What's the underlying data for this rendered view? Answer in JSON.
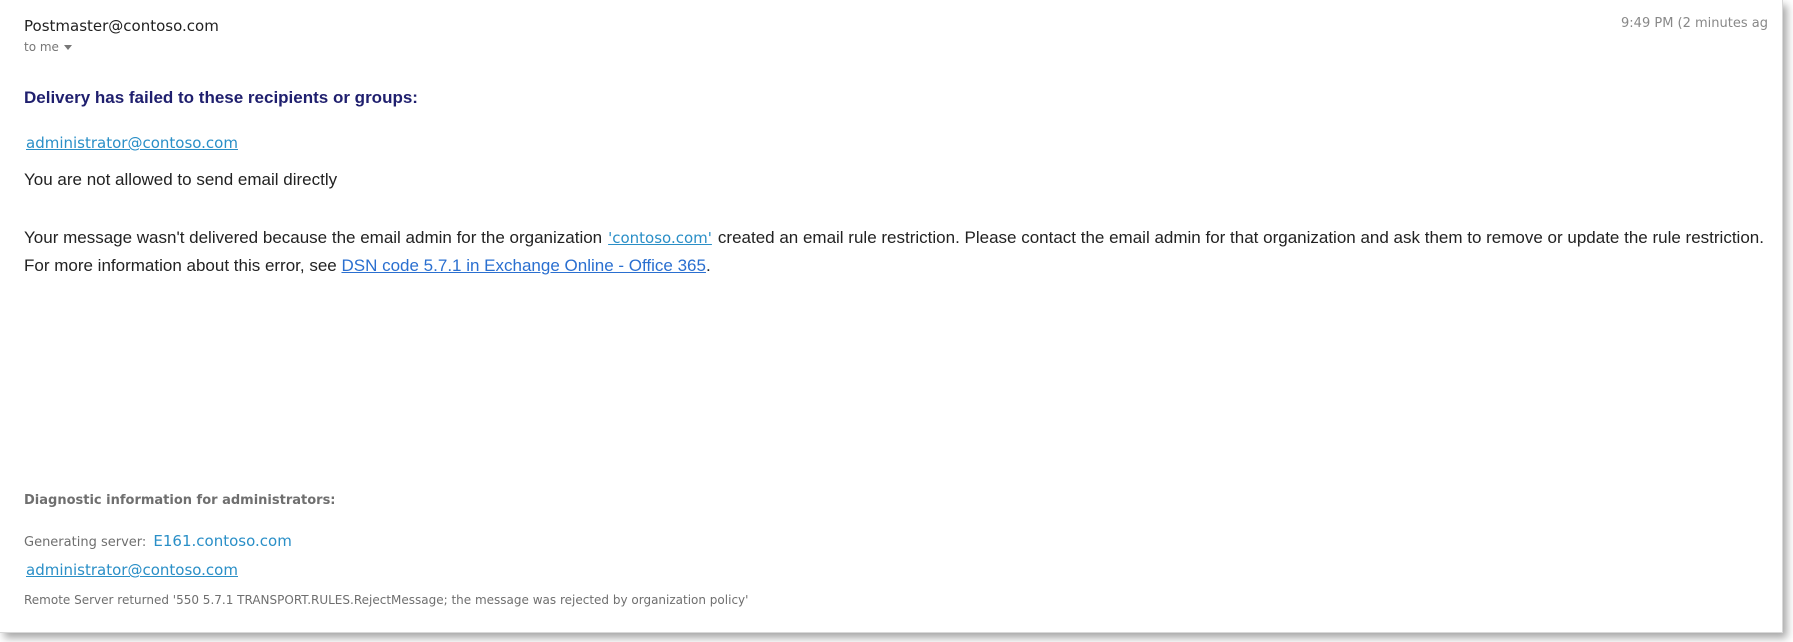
{
  "header": {
    "sender": "Postmaster@contoso.com",
    "to_label": "to me",
    "time": "9:49 PM (2 minutes ag"
  },
  "message": {
    "heading": "Delivery has failed to these recipients or groups:",
    "recipient": "administrator@contoso.com",
    "reason": "You are not allowed to send email directly",
    "body_prefix": "Your message wasn't delivered because the email admin for the organization",
    "org_link": "'contoso.com'",
    "body_suffix": "created an email rule restriction. Please contact the email admin for that organization and ask them to remove or update the rule restriction.",
    "more_info_prefix": "For more information about this error, see ",
    "dsn_link": "DSN code 5.7.1 in Exchange Online - Office 365",
    "more_info_suffix": "."
  },
  "diagnostics": {
    "heading": "Diagnostic information for administrators:",
    "server_label": "Generating server:",
    "server": "E161.contoso.com",
    "recipient": "administrator@contoso.com",
    "remote_message": "Remote Server returned '550 5.7.1 TRANSPORT.RULES.RejectMessage; the message was rejected by organization policy'"
  }
}
